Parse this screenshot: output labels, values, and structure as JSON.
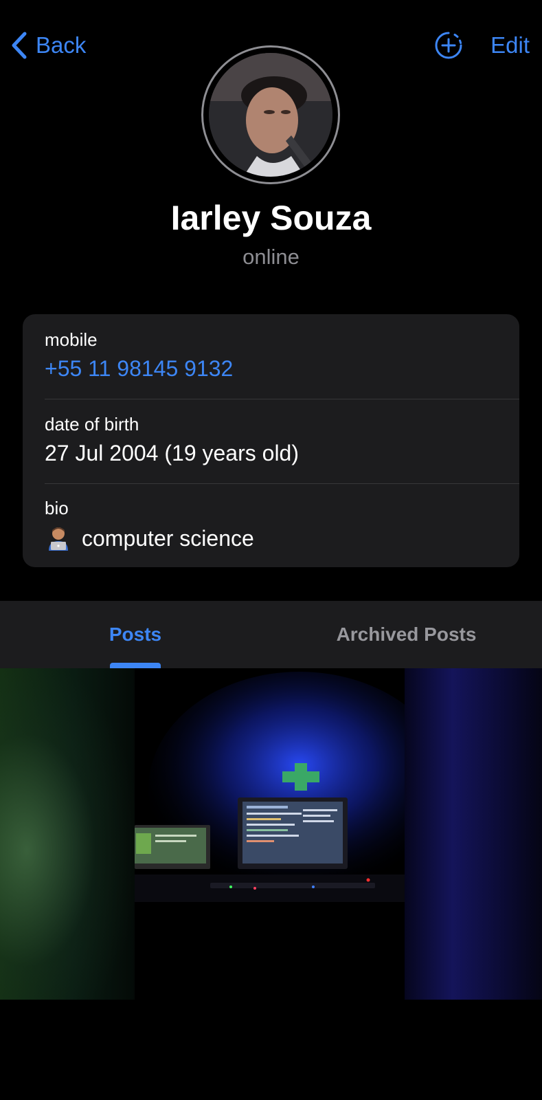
{
  "nav": {
    "back_label": "Back",
    "edit_label": "Edit"
  },
  "profile": {
    "name": "Iarley Souza",
    "status": "online"
  },
  "info": {
    "mobile_label": "mobile",
    "mobile_value": "+55 11 98145 9132",
    "dob_label": "date of birth",
    "dob_value": "27 Jul 2004 (19 years old)",
    "bio_label": "bio",
    "bio_value": "computer science"
  },
  "tabs": [
    {
      "label": "Posts",
      "active": true
    },
    {
      "label": "Archived Posts",
      "active": false
    }
  ],
  "colors": {
    "accent": "#3d86f5",
    "background": "#000000",
    "card": "#1c1c1e",
    "secondary_text": "#8e8e93"
  },
  "icons": {
    "back": "chevron-left-icon",
    "add_story": "add-story-icon",
    "bio_emoji": "technologist-emoji-icon"
  }
}
